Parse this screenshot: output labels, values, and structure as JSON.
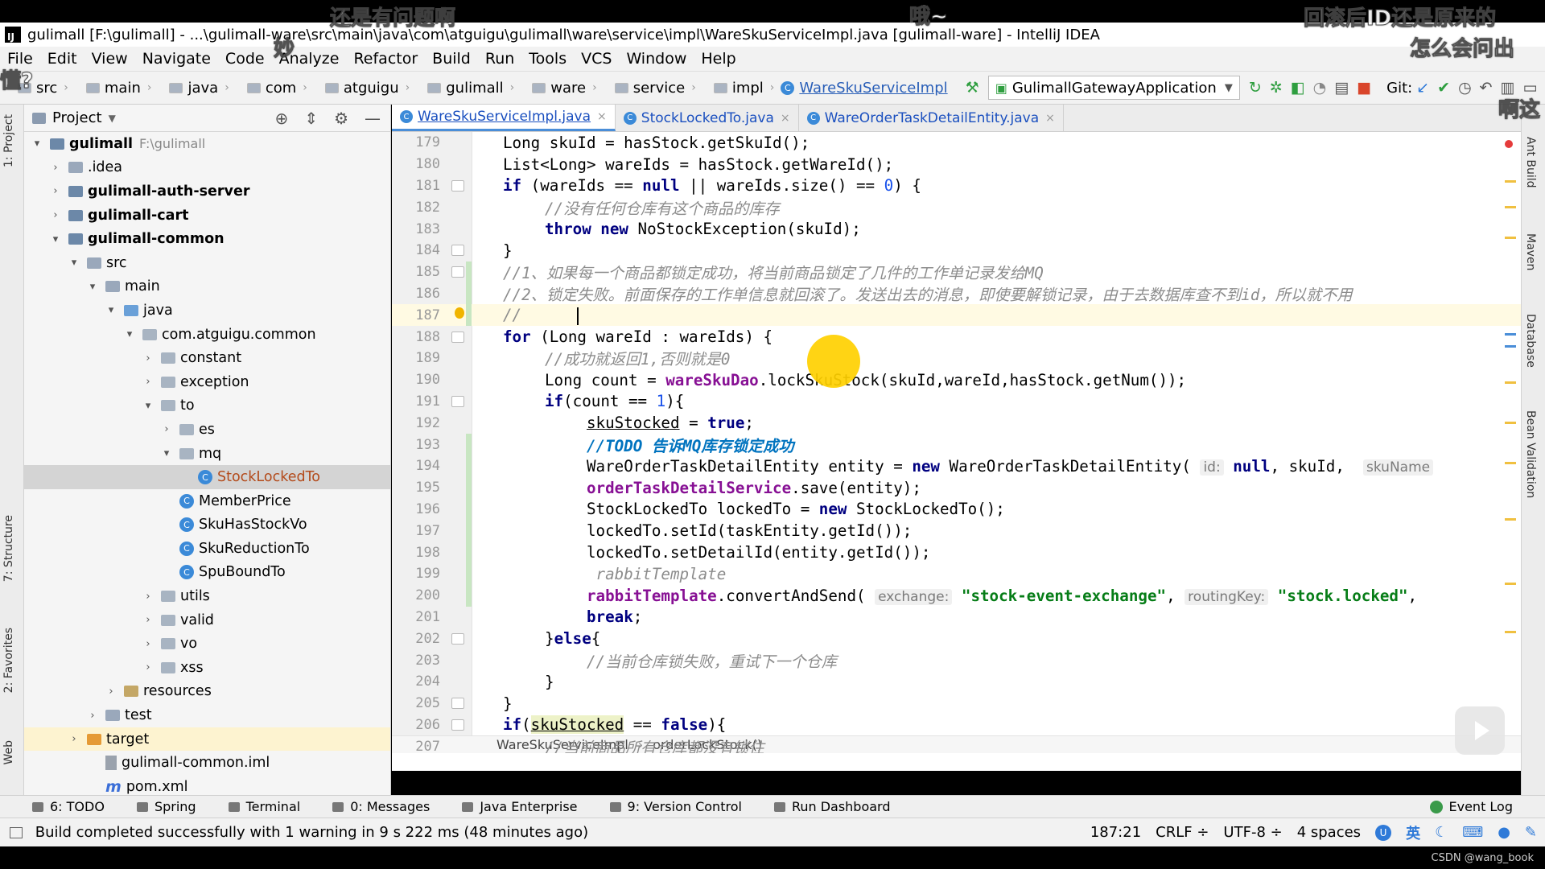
{
  "window": {
    "title": "gulimall [F:\\gulimall] - ...\\gulimall-ware\\src\\main\\java\\com\\atguigu\\gulimall\\ware\\service\\impl\\WareSkuServiceImpl.java [gulimall-ware] - IntelliJ IDEA"
  },
  "menu": [
    "File",
    "Edit",
    "View",
    "Navigate",
    "Code",
    "Analyze",
    "Refactor",
    "Build",
    "Run",
    "Tools",
    "VCS",
    "Window",
    "Help"
  ],
  "breadcrumb": [
    "src",
    "main",
    "java",
    "com",
    "atguigu",
    "gulimall",
    "ware",
    "service",
    "impl"
  ],
  "breadcrumb_class": "WareSkuServiceImpl",
  "run_config": "GulimallGatewayApplication",
  "git_label": "Git:",
  "left_tabs": [
    "1: Project",
    "7: Structure",
    "2: Favorites",
    "Web"
  ],
  "right_tabs": [
    "Ant Build",
    "Maven",
    "Database",
    "Bean Validation"
  ],
  "project": {
    "title": "Project",
    "tree": [
      {
        "label": "gulimall",
        "path": "F:\\gulimall",
        "depth": 0,
        "arrow": "open",
        "icon": "module",
        "bold": true
      },
      {
        "label": ".idea",
        "depth": 1,
        "arrow": "closed",
        "icon": "folder"
      },
      {
        "label": "gulimall-auth-server",
        "depth": 1,
        "arrow": "closed",
        "icon": "module",
        "bold": true
      },
      {
        "label": "gulimall-cart",
        "depth": 1,
        "arrow": "closed",
        "icon": "module",
        "bold": true
      },
      {
        "label": "gulimall-common",
        "depth": 1,
        "arrow": "open",
        "icon": "module",
        "bold": true
      },
      {
        "label": "src",
        "depth": 2,
        "arrow": "open",
        "icon": "folder"
      },
      {
        "label": "main",
        "depth": 3,
        "arrow": "open",
        "icon": "folder"
      },
      {
        "label": "java",
        "depth": 4,
        "arrow": "open",
        "icon": "source"
      },
      {
        "label": "com.atguigu.common",
        "depth": 5,
        "arrow": "open",
        "icon": "package"
      },
      {
        "label": "constant",
        "depth": 6,
        "arrow": "closed",
        "icon": "package"
      },
      {
        "label": "exception",
        "depth": 6,
        "arrow": "closed",
        "icon": "package"
      },
      {
        "label": "to",
        "depth": 6,
        "arrow": "open",
        "icon": "package"
      },
      {
        "label": "es",
        "depth": 7,
        "arrow": "closed",
        "icon": "package"
      },
      {
        "label": "mq",
        "depth": 7,
        "arrow": "open",
        "icon": "package"
      },
      {
        "label": "StockLockedTo",
        "depth": 8,
        "arrow": "none",
        "icon": "class",
        "selected": true
      },
      {
        "label": "MemberPrice",
        "depth": 7,
        "arrow": "none",
        "icon": "class"
      },
      {
        "label": "SkuHasStockVo",
        "depth": 7,
        "arrow": "none",
        "icon": "class"
      },
      {
        "label": "SkuReductionTo",
        "depth": 7,
        "arrow": "none",
        "icon": "class"
      },
      {
        "label": "SpuBoundTo",
        "depth": 7,
        "arrow": "none",
        "icon": "class"
      },
      {
        "label": "utils",
        "depth": 6,
        "arrow": "closed",
        "icon": "package"
      },
      {
        "label": "valid",
        "depth": 6,
        "arrow": "closed",
        "icon": "package"
      },
      {
        "label": "vo",
        "depth": 6,
        "arrow": "closed",
        "icon": "package"
      },
      {
        "label": "xss",
        "depth": 6,
        "arrow": "closed",
        "icon": "package"
      },
      {
        "label": "resources",
        "depth": 4,
        "arrow": "closed",
        "icon": "resources"
      },
      {
        "label": "test",
        "depth": 3,
        "arrow": "closed",
        "icon": "folder"
      },
      {
        "label": "target",
        "depth": 2,
        "arrow": "closed",
        "icon": "target",
        "highlight": true
      },
      {
        "label": "gulimall-common.iml",
        "depth": 3,
        "arrow": "none",
        "icon": "file"
      },
      {
        "label": "pom.xml",
        "depth": 3,
        "arrow": "none",
        "icon": "maven"
      }
    ]
  },
  "tabs": [
    {
      "label": "WareSkuServiceImpl.java",
      "active": true
    },
    {
      "label": "StockLockedTo.java",
      "active": false
    },
    {
      "label": "WareOrderTaskDetailEntity.java",
      "active": false
    }
  ],
  "code": {
    "cursor_line": 187,
    "lines": [
      {
        "n": 179,
        "fold": false,
        "change": false,
        "indent": 0,
        "tokens": [
          [
            "",
            "Long skuId = hasStock.getSkuId();"
          ]
        ]
      },
      {
        "n": 180,
        "fold": false,
        "change": false,
        "indent": 0,
        "tokens": [
          [
            "",
            "List<Long> wareIds = hasStock.getWareId();"
          ]
        ]
      },
      {
        "n": 181,
        "fold": true,
        "change": false,
        "indent": 0,
        "tokens": [
          [
            "k",
            "if"
          ],
          [
            "",
            " (wareIds == "
          ],
          [
            "k",
            "null"
          ],
          [
            "",
            " || wareIds.size() == "
          ],
          [
            "n",
            "0"
          ],
          [
            "",
            ") {"
          ]
        ]
      },
      {
        "n": 182,
        "fold": false,
        "change": false,
        "indent": 1,
        "tokens": [
          [
            "c",
            "//没有任何仓库有这个商品的库存"
          ]
        ]
      },
      {
        "n": 183,
        "fold": false,
        "change": false,
        "indent": 1,
        "tokens": [
          [
            "k",
            "throw new"
          ],
          [
            "",
            " NoStockException(skuId);"
          ]
        ]
      },
      {
        "n": 184,
        "fold": true,
        "change": false,
        "indent": 0,
        "tokens": [
          [
            "",
            "}"
          ]
        ]
      },
      {
        "n": 185,
        "fold": true,
        "change": true,
        "indent": 0,
        "tokens": [
          [
            "c",
            "//1、如果每一个商品都锁定成功，将当前商品锁定了几件的工作单记录发给MQ"
          ]
        ]
      },
      {
        "n": 186,
        "fold": false,
        "change": true,
        "indent": 0,
        "tokens": [
          [
            "c",
            "//2、锁定失败。前面保存的工作单信息就回滚了。发送出去的消息，即使要解锁记录，由于去数据库查不到id，所以就不用"
          ]
        ]
      },
      {
        "n": 187,
        "fold": false,
        "change": true,
        "indent": 0,
        "tokens": [
          [
            "c",
            "//      "
          ]
        ]
      },
      {
        "n": 188,
        "fold": true,
        "change": false,
        "indent": 0,
        "tokens": [
          [
            "k",
            "for"
          ],
          [
            "",
            " (Long wareId : wareIds) {"
          ]
        ]
      },
      {
        "n": 189,
        "fold": false,
        "change": false,
        "indent": 1,
        "tokens": [
          [
            "c",
            "//成功就返回1,否则就是0"
          ]
        ]
      },
      {
        "n": 190,
        "fold": false,
        "change": false,
        "indent": 1,
        "tokens": [
          [
            "",
            "Long count = "
          ],
          [
            "f",
            "wareSkuDao"
          ],
          [
            "",
            ".lockSkuStock(skuId,wareId,hasStock.getNum());"
          ]
        ]
      },
      {
        "n": 191,
        "fold": true,
        "change": false,
        "indent": 1,
        "tokens": [
          [
            "k",
            "if"
          ],
          [
            "",
            "(count == "
          ],
          [
            "n",
            "1"
          ],
          [
            "",
            "){"
          ]
        ]
      },
      {
        "n": 192,
        "fold": false,
        "change": false,
        "indent": 2,
        "tokens": [
          [
            "u",
            "skuStocked"
          ],
          [
            "",
            " = "
          ],
          [
            "k",
            "true"
          ],
          [
            "",
            ";"
          ]
        ]
      },
      {
        "n": 193,
        "fold": false,
        "change": true,
        "indent": 2,
        "tokens": [
          [
            "todo",
            "//TODO 告诉MQ库存锁定成功"
          ]
        ]
      },
      {
        "n": 194,
        "fold": false,
        "change": true,
        "indent": 2,
        "tokens": [
          [
            "",
            "WareOrderTaskDetailEntity entity = "
          ],
          [
            "k",
            "new"
          ],
          [
            "",
            " WareOrderTaskDetailEntity( "
          ],
          [
            "hint",
            "id:"
          ],
          [
            "",
            " "
          ],
          [
            "k",
            "null"
          ],
          [
            "",
            ", skuId,  "
          ],
          [
            "hint",
            "skuName"
          ]
        ]
      },
      {
        "n": 195,
        "fold": false,
        "change": true,
        "indent": 2,
        "tokens": [
          [
            "f",
            "orderTaskDetailService"
          ],
          [
            "",
            ".save(entity);"
          ]
        ]
      },
      {
        "n": 196,
        "fold": false,
        "change": true,
        "indent": 2,
        "tokens": [
          [
            "",
            "StockLockedTo lockedTo = "
          ],
          [
            "k",
            "new"
          ],
          [
            "",
            " StockLockedTo();"
          ]
        ]
      },
      {
        "n": 197,
        "fold": false,
        "change": true,
        "indent": 2,
        "tokens": [
          [
            "",
            "lockedTo.setId(taskEntity.getId());"
          ]
        ]
      },
      {
        "n": 198,
        "fold": false,
        "change": true,
        "indent": 2,
        "tokens": [
          [
            "",
            "lockedTo.setDetailId(entity.getId());"
          ]
        ]
      },
      {
        "n": 199,
        "fold": false,
        "change": true,
        "indent": 2,
        "tokens": [
          [
            "c",
            " rabbitTemplate"
          ]
        ]
      },
      {
        "n": 200,
        "fold": false,
        "change": true,
        "indent": 2,
        "tokens": [
          [
            "f",
            "rabbitTemplate"
          ],
          [
            "",
            ".convertAndSend( "
          ],
          [
            "hint",
            "exchange:"
          ],
          [
            "",
            " "
          ],
          [
            "s",
            "\"stock-event-exchange\""
          ],
          [
            "",
            ", "
          ],
          [
            "hint",
            "routingKey:"
          ],
          [
            "",
            " "
          ],
          [
            "s",
            "\"stock.locked\""
          ],
          [
            "",
            ","
          ]
        ]
      },
      {
        "n": 201,
        "fold": false,
        "change": false,
        "indent": 2,
        "tokens": [
          [
            "k",
            "break"
          ],
          [
            "",
            ";"
          ]
        ]
      },
      {
        "n": 202,
        "fold": true,
        "change": false,
        "indent": 1,
        "tokens": [
          [
            "",
            "}"
          ],
          [
            "k",
            "else"
          ],
          [
            "",
            "{"
          ]
        ]
      },
      {
        "n": 203,
        "fold": false,
        "change": false,
        "indent": 2,
        "tokens": [
          [
            "c",
            "//当前仓库锁失败，重试下一个仓库"
          ]
        ]
      },
      {
        "n": 204,
        "fold": false,
        "change": false,
        "indent": 1,
        "tokens": [
          [
            "",
            "}"
          ]
        ]
      },
      {
        "n": 205,
        "fold": true,
        "change": false,
        "indent": 0,
        "tokens": [
          [
            "",
            "}"
          ]
        ]
      },
      {
        "n": 206,
        "fold": true,
        "change": false,
        "indent": 0,
        "tokens": [
          [
            "k",
            "if"
          ],
          [
            "",
            "("
          ],
          [
            "hlu",
            "skuStocked"
          ],
          [
            "",
            " == "
          ],
          [
            "k",
            "false"
          ],
          [
            "",
            "){"
          ]
        ]
      },
      {
        "n": 207,
        "fold": false,
        "change": false,
        "indent": 1,
        "tokens": [
          [
            "c",
            "//当前商品所有仓库都没有锁住"
          ]
        ]
      }
    ]
  },
  "editor_breadcrumb": [
    "WareSkuServiceImpl",
    "orderLockStock()"
  ],
  "bottom_tools": [
    "6: TODO",
    "Spring",
    "Terminal",
    "0: Messages",
    "Java Enterprise",
    "9: Version Control",
    "Run Dashboard"
  ],
  "event_log": "Event Log",
  "status": {
    "message": "Build completed successfully with 1 warning in 9 s 222 ms (48 minutes ago)",
    "position": "187:21",
    "line_sep": "CRLF ÷",
    "encoding": "UTF-8 ÷",
    "indent": "4 spaces",
    "ime": "英"
  },
  "watermark": "CSDN @wang_book",
  "danmaku": [
    "还是有问题啊",
    "哦~",
    "回滚后ID还是原来的",
    "怎么会问出",
    "妙",
    "懂?",
    "啊这"
  ],
  "colors": {
    "accent": "#4a8ed8",
    "keyword": "#000080",
    "string": "#067d17",
    "comment": "#8c8c8c",
    "field": "#871094"
  }
}
